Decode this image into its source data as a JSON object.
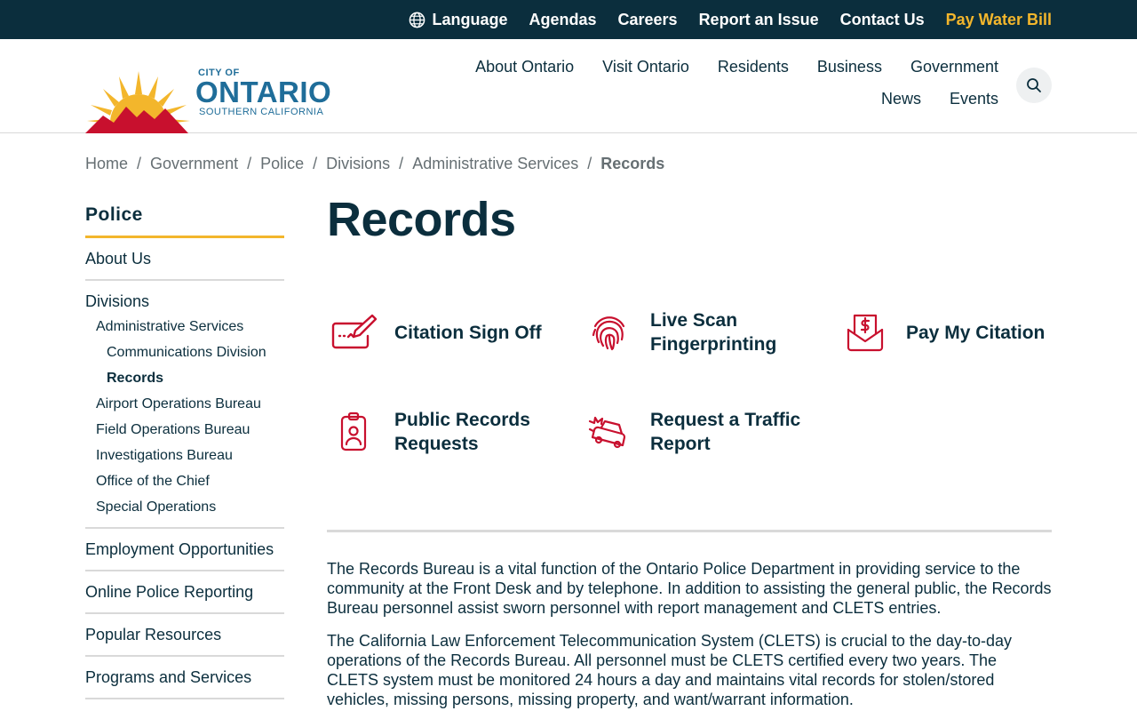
{
  "utility_nav": {
    "language": "Language",
    "agendas": "Agendas",
    "careers": "Careers",
    "report_issue": "Report an Issue",
    "contact": "Contact Us",
    "pay_water_bill": "Pay Water Bill"
  },
  "logo": {
    "city_of": "CITY OF",
    "name": "ONTARIO",
    "region": "SOUTHERN CALIFORNIA"
  },
  "main_nav": {
    "row1": [
      "About Ontario",
      "Visit Ontario",
      "Residents",
      "Business",
      "Government"
    ],
    "row2": [
      "News",
      "Events"
    ]
  },
  "breadcrumb": {
    "items": [
      "Home",
      "Government",
      "Police",
      "Divisions",
      "Administrative Services"
    ],
    "separator": "/",
    "current": "Records"
  },
  "sidebar": {
    "title": "Police",
    "about": "About Us",
    "divisions": {
      "label": "Divisions",
      "admin": "Administrative Services",
      "admin_children": [
        "Communications Division",
        "Records"
      ],
      "others": [
        "Airport Operations Bureau",
        "Field Operations Bureau",
        "Investigations Bureau",
        "Office of the Chief",
        "Special Operations"
      ]
    },
    "employment": "Employment Opportunities",
    "online_reporting": "Online Police Reporting",
    "popular": "Popular Resources",
    "programs": "Programs and Services"
  },
  "main": {
    "title": "Records",
    "cards": [
      {
        "label": "Citation Sign Off",
        "icon": "signature-icon"
      },
      {
        "label": "Live Scan Fingerprinting",
        "icon": "fingerprint-icon"
      },
      {
        "label": "Pay My Citation",
        "icon": "envelope-dollar-icon"
      },
      {
        "label": "Public Records Requests",
        "icon": "id-badge-icon"
      },
      {
        "label": "Request a Traffic Report",
        "icon": "car-crash-icon"
      }
    ],
    "paragraphs": [
      "The Records Bureau is a vital function of the Ontario Police Department in providing service to the community at the Front Desk and by telephone. In addition to assisting the general public, the Records Bureau personnel assist sworn personnel with report management and CLETS entries.",
      "The California Law Enforcement Telecommunication System (CLETS) is crucial to the day-to-day operations of the Records Bureau. All personnel must be CLETS certified every two years. The CLETS system must be monitored 24 hours a day and maintains vital records for stolen/stored vehicles, missing persons, missing property, and want/warrant information."
    ]
  },
  "colors": {
    "navy": "#0b2e3d",
    "gold": "#f3b62c",
    "crimson": "#c8102e",
    "logo_blue": "#1f6d99",
    "divider": "#d9d9d9"
  }
}
